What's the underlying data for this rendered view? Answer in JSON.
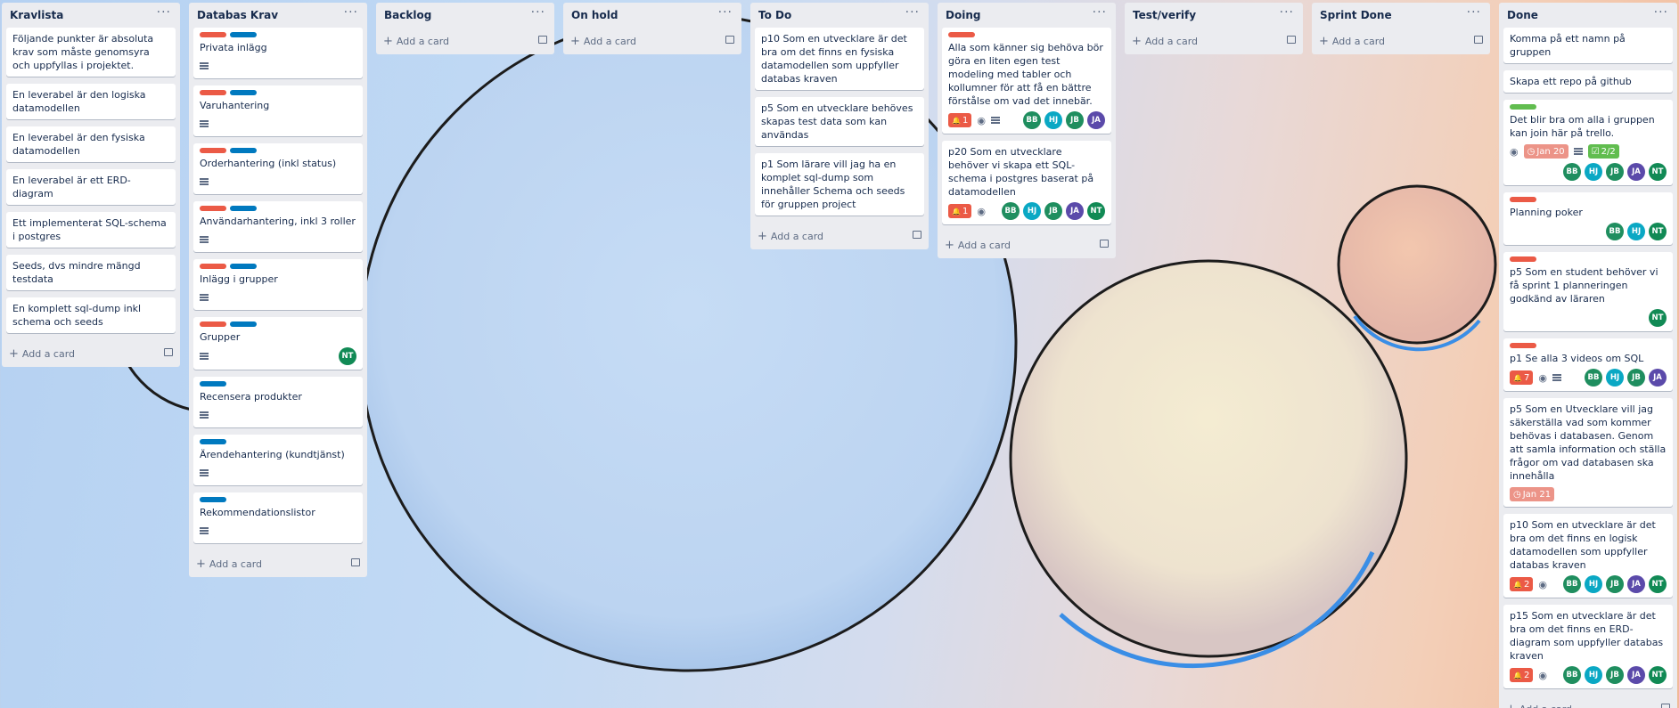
{
  "lists": [
    {
      "title": "Kravlista",
      "cards": [
        {
          "text": "Följande punkter är absoluta krav som måste genomsyra och uppfyllas i projektet."
        },
        {
          "text": "En leverabel är den logiska datamodellen"
        },
        {
          "text": "En leverabel är den fysiska datamodellen"
        },
        {
          "text": "En leverabel är ett ERD-diagram"
        },
        {
          "text": "Ett implementerat SQL-schema i postgres"
        },
        {
          "text": "Seeds, dvs mindre mängd testdata"
        },
        {
          "text": "En komplett sql-dump inkl schema och seeds"
        }
      ],
      "add_label": "Add a card"
    },
    {
      "title": "Databas Krav",
      "cards": [
        {
          "labels": [
            "red",
            "blue"
          ],
          "text": "Privata inlägg",
          "desc": true
        },
        {
          "labels": [
            "red",
            "blue"
          ],
          "text": "Varuhantering",
          "desc": true
        },
        {
          "labels": [
            "red",
            "blue"
          ],
          "text": "Orderhantering (inkl status)",
          "desc": true
        },
        {
          "labels": [
            "red",
            "blue"
          ],
          "text": "Användarhantering, inkl 3 roller",
          "desc": true
        },
        {
          "labels": [
            "red",
            "blue"
          ],
          "text": "Inlägg i grupper",
          "desc": true
        },
        {
          "labels": [
            "red",
            "blue"
          ],
          "text": "Grupper",
          "desc": true,
          "members": [
            "NT"
          ]
        },
        {
          "labels": [
            "blue"
          ],
          "text": "Recensera produkter",
          "desc": true
        },
        {
          "labels": [
            "blue"
          ],
          "text": "Ärendehantering (kundtjänst)",
          "desc": true
        },
        {
          "labels": [
            "blue"
          ],
          "text": "Rekommendationslistor",
          "desc": true
        }
      ],
      "add_label": "Add a card"
    },
    {
      "title": "Backlog",
      "cards": [],
      "add_label": "Add a card"
    },
    {
      "title": "On hold",
      "cards": [],
      "add_label": "Add a card"
    },
    {
      "title": "To Do",
      "cards": [
        {
          "text": "p10 Som en utvecklare är det bra om det finns en fysiska datamodellen som uppfyller databas kraven"
        },
        {
          "text": "p5 Som en utvecklare behöves skapas test data som kan användas"
        },
        {
          "text": "p1 Som lärare vill jag ha en komplet sql-dump som innehåller Schema och seeds för gruppen project"
        }
      ],
      "add_label": "Add a card"
    },
    {
      "title": "Doing",
      "cards": [
        {
          "labels": [
            "red"
          ],
          "text": "Alla som känner sig behöva bör göra en liten egen test modeling med tabler och kollumner för att få en bättre förstålse om vad det innebär.",
          "bell": "1",
          "eye": true,
          "desc": true,
          "members": [
            "BB",
            "HJ",
            "JB",
            "JA"
          ]
        },
        {
          "text": "p20 Som en utvecklare behöver vi skapa ett SQL-schema i postgres baserat på datamodellen",
          "bell": "1",
          "eye": true,
          "members": [
            "BB",
            "HJ",
            "JB",
            "JA",
            "NT"
          ]
        }
      ],
      "add_label": "Add a card"
    },
    {
      "title": "Test/verify",
      "cards": [],
      "add_label": "Add a card"
    },
    {
      "title": "Sprint Done",
      "cards": [],
      "add_label": "Add a card"
    },
    {
      "title": "Done",
      "cards": [
        {
          "text": "Komma på ett namn på gruppen"
        },
        {
          "text": "Skapa ett repo på github"
        },
        {
          "labels": [
            "green"
          ],
          "text": "Det blir bra om alla i gruppen kan join här på trello.",
          "eye": true,
          "due": "Jan 20",
          "desc": true,
          "checklist": "2/2",
          "members_row": [
            "BB",
            "HJ",
            "JB",
            "JA",
            "NT"
          ]
        },
        {
          "labels": [
            "red"
          ],
          "text": "Planning poker",
          "members_row": [
            "BB",
            "HJ",
            "NT"
          ]
        },
        {
          "labels": [
            "red"
          ],
          "text": "p5 Som en student behöver vi få sprint 1 planneringen godkänd av läraren",
          "members_row": [
            "NT"
          ]
        },
        {
          "labels": [
            "red"
          ],
          "text": "p1 Se alla 3 videos om SQL",
          "bell": "7",
          "eye": true,
          "desc": true,
          "members": [
            "BB",
            "HJ",
            "JB",
            "JA"
          ]
        },
        {
          "text": "p5 Som en Utvecklare vill jag säkerställa vad som kommer behövas i databasen. Genom att samla information och ställa frågor om vad databasen ska innehålla",
          "due": "Jan 21"
        },
        {
          "text": "p10 Som en utvecklare är det bra om det finns en logisk datamodellen som uppfyller databas kraven",
          "bell": "2",
          "eye": true,
          "members": [
            "BB",
            "HJ",
            "JB",
            "JA",
            "NT"
          ]
        },
        {
          "text": "p15 Som en utvecklare är det bra om det finns en ERD-diagram som uppfyller databas kraven",
          "bell": "2",
          "eye": true,
          "members": [
            "BB",
            "HJ",
            "JB",
            "JA",
            "NT"
          ]
        }
      ],
      "add_label": "Add a card"
    }
  ],
  "icons": {
    "menu": "…",
    "bell": "bell-icon",
    "eye": "eye-icon",
    "clock": "clock-icon",
    "checklist": "checklist-icon"
  }
}
